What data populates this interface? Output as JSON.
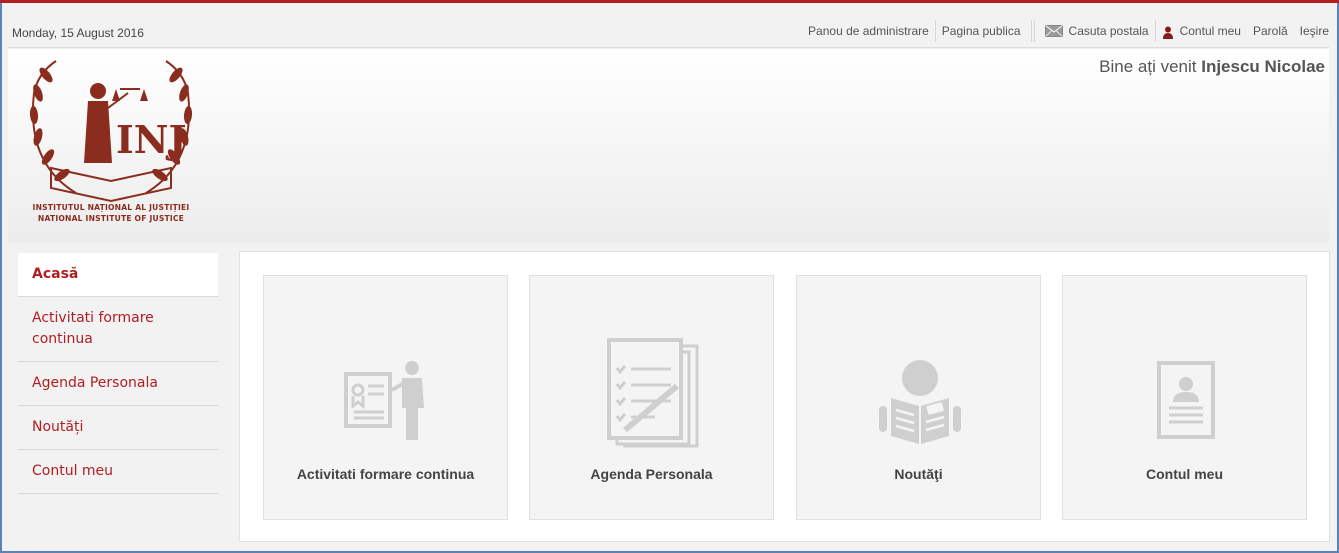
{
  "topbar": {
    "date": "Monday, 15 August 2016",
    "links": {
      "admin": "Panou de administrare",
      "public": "Pagina publica",
      "mailbox": "Casuta postala",
      "account": "Contul meu",
      "password": "Parolă",
      "logout": "Ieşire"
    }
  },
  "header": {
    "welcome_prefix": "Bine ați venit",
    "user_name": "Injescu Nicolae",
    "logo_line1": "INSTITUTUL NAȚIONAL AL JUSTIȚIEI",
    "logo_line2": "NATIONAL INSTITUTE OF JUSTICE"
  },
  "sidebar": {
    "items": [
      {
        "label": "Acasă"
      },
      {
        "label": "Activitati formare continua"
      },
      {
        "label": "Agenda Personala"
      },
      {
        "label": "Noutăți"
      },
      {
        "label": "Contul meu"
      }
    ]
  },
  "tiles": [
    {
      "label": "Activitati formare continua",
      "icon": "presentation-icon"
    },
    {
      "label": "Agenda Personala",
      "icon": "checklist-icon"
    },
    {
      "label": "Noutăţi",
      "icon": "newspaper-reader-icon"
    },
    {
      "label": "Contul meu",
      "icon": "profile-card-icon"
    }
  ],
  "colors": {
    "accent": "#b01e23",
    "frame": "#5b83b8",
    "icon_gray": "#cfcfcf"
  }
}
